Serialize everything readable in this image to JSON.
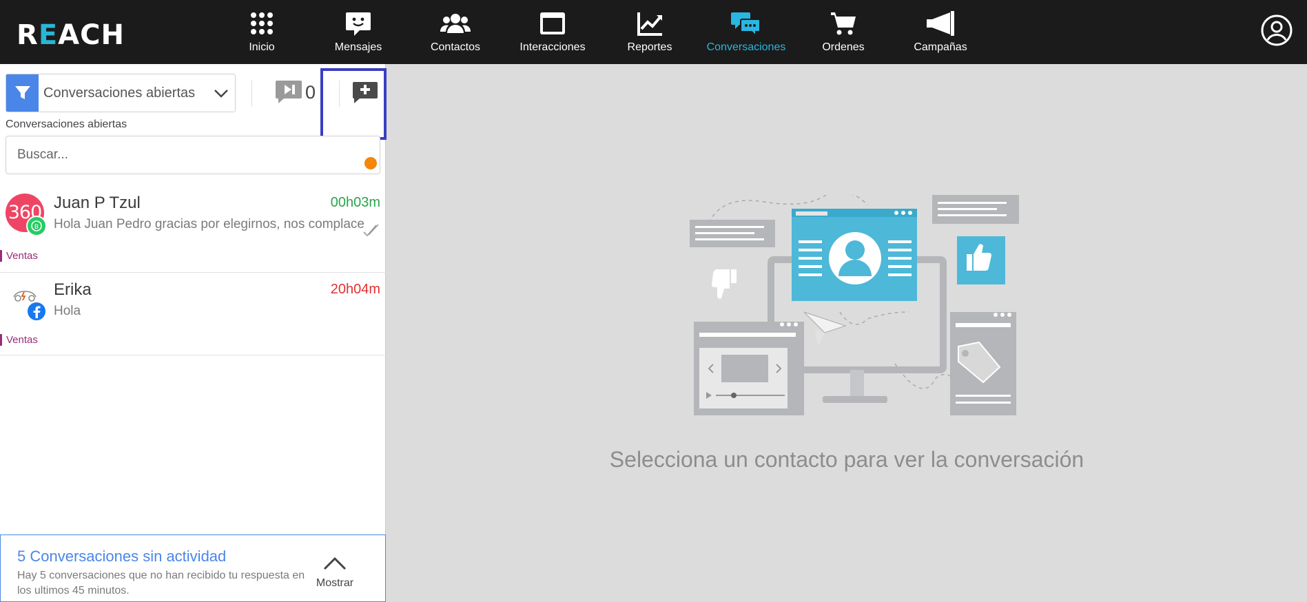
{
  "brand": {
    "name_prefix": "R",
    "name_accent": "E",
    "name_suffix": "ACH",
    "accent_color": "#29b6d6"
  },
  "nav": {
    "items": [
      {
        "label": "Inicio",
        "icon": "grid-icon"
      },
      {
        "label": "Mensajes",
        "icon": "message-smile-icon"
      },
      {
        "label": "Contactos",
        "icon": "users-icon"
      },
      {
        "label": "Interacciones",
        "icon": "window-icon"
      },
      {
        "label": "Reportes",
        "icon": "chart-line-icon"
      },
      {
        "label": "Conversaciones",
        "icon": "chat-bubbles-icon",
        "active": true
      },
      {
        "label": "Ordenes",
        "icon": "cart-icon"
      },
      {
        "label": "Campañas",
        "icon": "megaphone-icon"
      }
    ],
    "active_color": "#29b6e0"
  },
  "sidebar": {
    "filter_value": "Conversaciones abiertas",
    "filter_caption": "Conversaciones abiertas",
    "queue_count": "0",
    "search_placeholder": "Buscar...",
    "conversations": [
      {
        "name": "Juan P Tzul",
        "time": "00h03m",
        "message": "Hola Juan Pedro gracias por elegirnos, nos complace",
        "tag": "Ventas",
        "avatar_text": "360",
        "channel": "whatsapp-icon",
        "status": "read-double-check"
      },
      {
        "name": "Erika",
        "time": "20h04m",
        "message": "Hola",
        "tag": "Ventas",
        "channel": "facebook-icon",
        "status": "unread-dot"
      }
    ],
    "inactive": {
      "title": "5 Conversaciones sin actividad",
      "description": "Hay 5 conversaciones que no han recibido tu respuesta en los ultimos 45 minutos.",
      "action": "Mostrar"
    }
  },
  "main": {
    "placeholder": "Selecciona un contacto para ver la conversación"
  }
}
